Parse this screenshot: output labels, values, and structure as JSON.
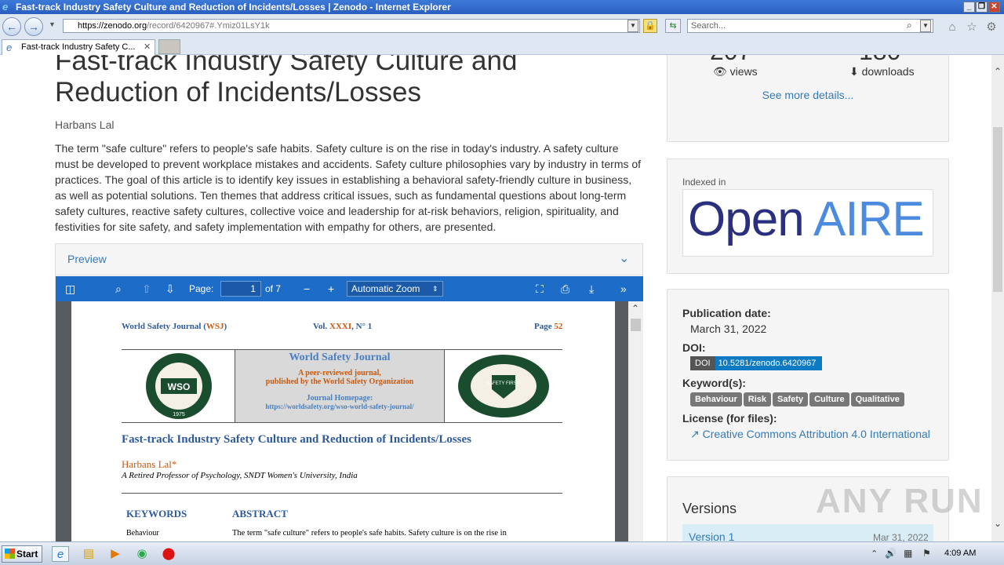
{
  "window": {
    "title": "Fast-track Industry Safety Culture and Reduction of Incidents/Losses | Zenodo - Internet Explorer"
  },
  "browser": {
    "url_host": "https://zenodo.org",
    "url_path": "/record/6420967#.Ymiz01LsY1k",
    "search_placeholder": "Search...",
    "tab_label": "Fast-track Industry Safety C...",
    "tab_close": "✕"
  },
  "record": {
    "title": "Fast-track Industry Safety Culture and Reduction of Incidents/Losses",
    "author": "Harbans Lal",
    "description": "The term \"safe culture\" refers to people's safe habits. Safety culture is on the rise in today's industry. A safety culture must be developed to prevent workplace mistakes and accidents. Safety culture philosophies vary by industry in terms of practices. The goal of this article is to identify key issues in establishing a behavioral safety-friendly culture in business, as well as potential solutions. Ten themes that address critical issues, such as fundamental questions about long-term safety cultures, reactive safety cultures, collective voice and leadership for at-risk behaviors, religion, spirituality, and festivities for site safety, and safety implementation with empathy for others, are presented."
  },
  "preview": {
    "heading": "Preview",
    "page_label": "Page:",
    "page_value": "1",
    "page_of": "of 7",
    "zoom": "Automatic Zoom",
    "pdf": {
      "journal": "World Safety Journal (",
      "journal_abbr": "WSJ",
      "journal_close": ")",
      "vol": "Vol. ",
      "vol_num": "XXXI",
      "vol_no": ", N° 1",
      "page": "Page ",
      "page_num": "52",
      "banner_title": "World Safety Journal",
      "banner_line1": "A peer-reviewed journal,",
      "banner_line2": "published by the World Safety Organization",
      "banner_home": "Journal Homepage:",
      "banner_url": "https://worldsafety.org/wso-world-safety-journal/",
      "logo_left_text": "WSO",
      "logo_left_year": "1975",
      "logo_right_text": "SAFETY FIRST!",
      "article_title": "Fast-track Industry Safety Culture and Reduction of Incidents/Losses",
      "author": "Harbans Lal*",
      "affiliation": "A Retired Professor of Psychology, SNDT Women's University, India",
      "kw_head": "KEYWORDS",
      "abs_head": "ABSTRACT",
      "kw1": "Behaviour",
      "abs_line": "The term \"safe culture\" refers to people's safe habits. Safety culture is on the rise in"
    }
  },
  "stats": {
    "views_number": "207",
    "downloads_number": "180",
    "views_label": "views",
    "downloads_label": "downloads",
    "more": "See more details..."
  },
  "indexed": {
    "label": "Indexed in",
    "logo_open": "Open",
    "logo_aire": "AIRE"
  },
  "meta": {
    "pubdate_label": "Publication date:",
    "pubdate": "March 31, 2022",
    "doi_label": "DOI:",
    "doi_prefix": "DOI",
    "doi": "10.5281/zenodo.6420967",
    "keywords_label": "Keyword(s):",
    "keywords": [
      "Behaviour",
      "Risk",
      "Safety",
      "Culture",
      "Qualitative"
    ],
    "license_label": "License (for files):",
    "license": "Creative Commons Attribution 4.0 International"
  },
  "versions": {
    "heading": "Versions",
    "v1": "Version 1",
    "v1_date": "Mar 31, 2022"
  },
  "watermark": "ANY RUN",
  "taskbar": {
    "start": "Start",
    "clock": "4:09 AM"
  }
}
